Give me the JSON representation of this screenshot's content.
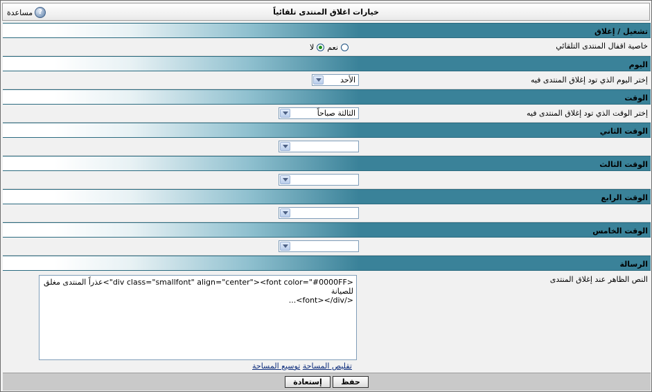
{
  "window": {
    "title": "خيارات اغلاق المنتدى تلقائياً",
    "help_label": "مساعدة"
  },
  "sections": {
    "onoff": "تشغيل / إغلاق",
    "day": "اليوم",
    "time": "الوقت",
    "time2": "الوقت الثاني",
    "time3": "الوقت الثالث",
    "time4": "الوقت الرابع",
    "time5": "الوقت الخامس",
    "message": "الرسالة"
  },
  "fields": {
    "autoclose_label": "خاصية اقفال المنتدى التلقائي",
    "yes_label": "نعم",
    "no_label": "لا",
    "yes_selected": true,
    "day_label": "إختر اليوم الذي تود إغلاق المنتدى فيه",
    "day_value": "الأحد",
    "time_label": "إختر الوقت الذي تود إغلاق المنتدى فيه",
    "time_value": "الثالثة صباحاً",
    "time2_value": "",
    "time3_value": "",
    "time4_value": "",
    "time5_value": "",
    "message_label": "النص الظاهر عند إغلاق المنتدى",
    "message_line1": "<div class=\"smallfont\" align=\"center\"><font color=\"#0000FF\">عذراً المنتدى مغلق للصيانة",
    "message_line2": "</font></div>...",
    "expand_link": "توسيع المساحة",
    "shrink_link": "تقليص المساحة"
  },
  "buttons": {
    "save": "حفظ",
    "reset": "إستعادة"
  },
  "icons": {
    "help": "help-icon",
    "dropdown": "chevron-down-icon"
  },
  "colors": {
    "section_header": "#3a8299",
    "background": "#f1f1f1",
    "footer": "#c9c9c9"
  }
}
